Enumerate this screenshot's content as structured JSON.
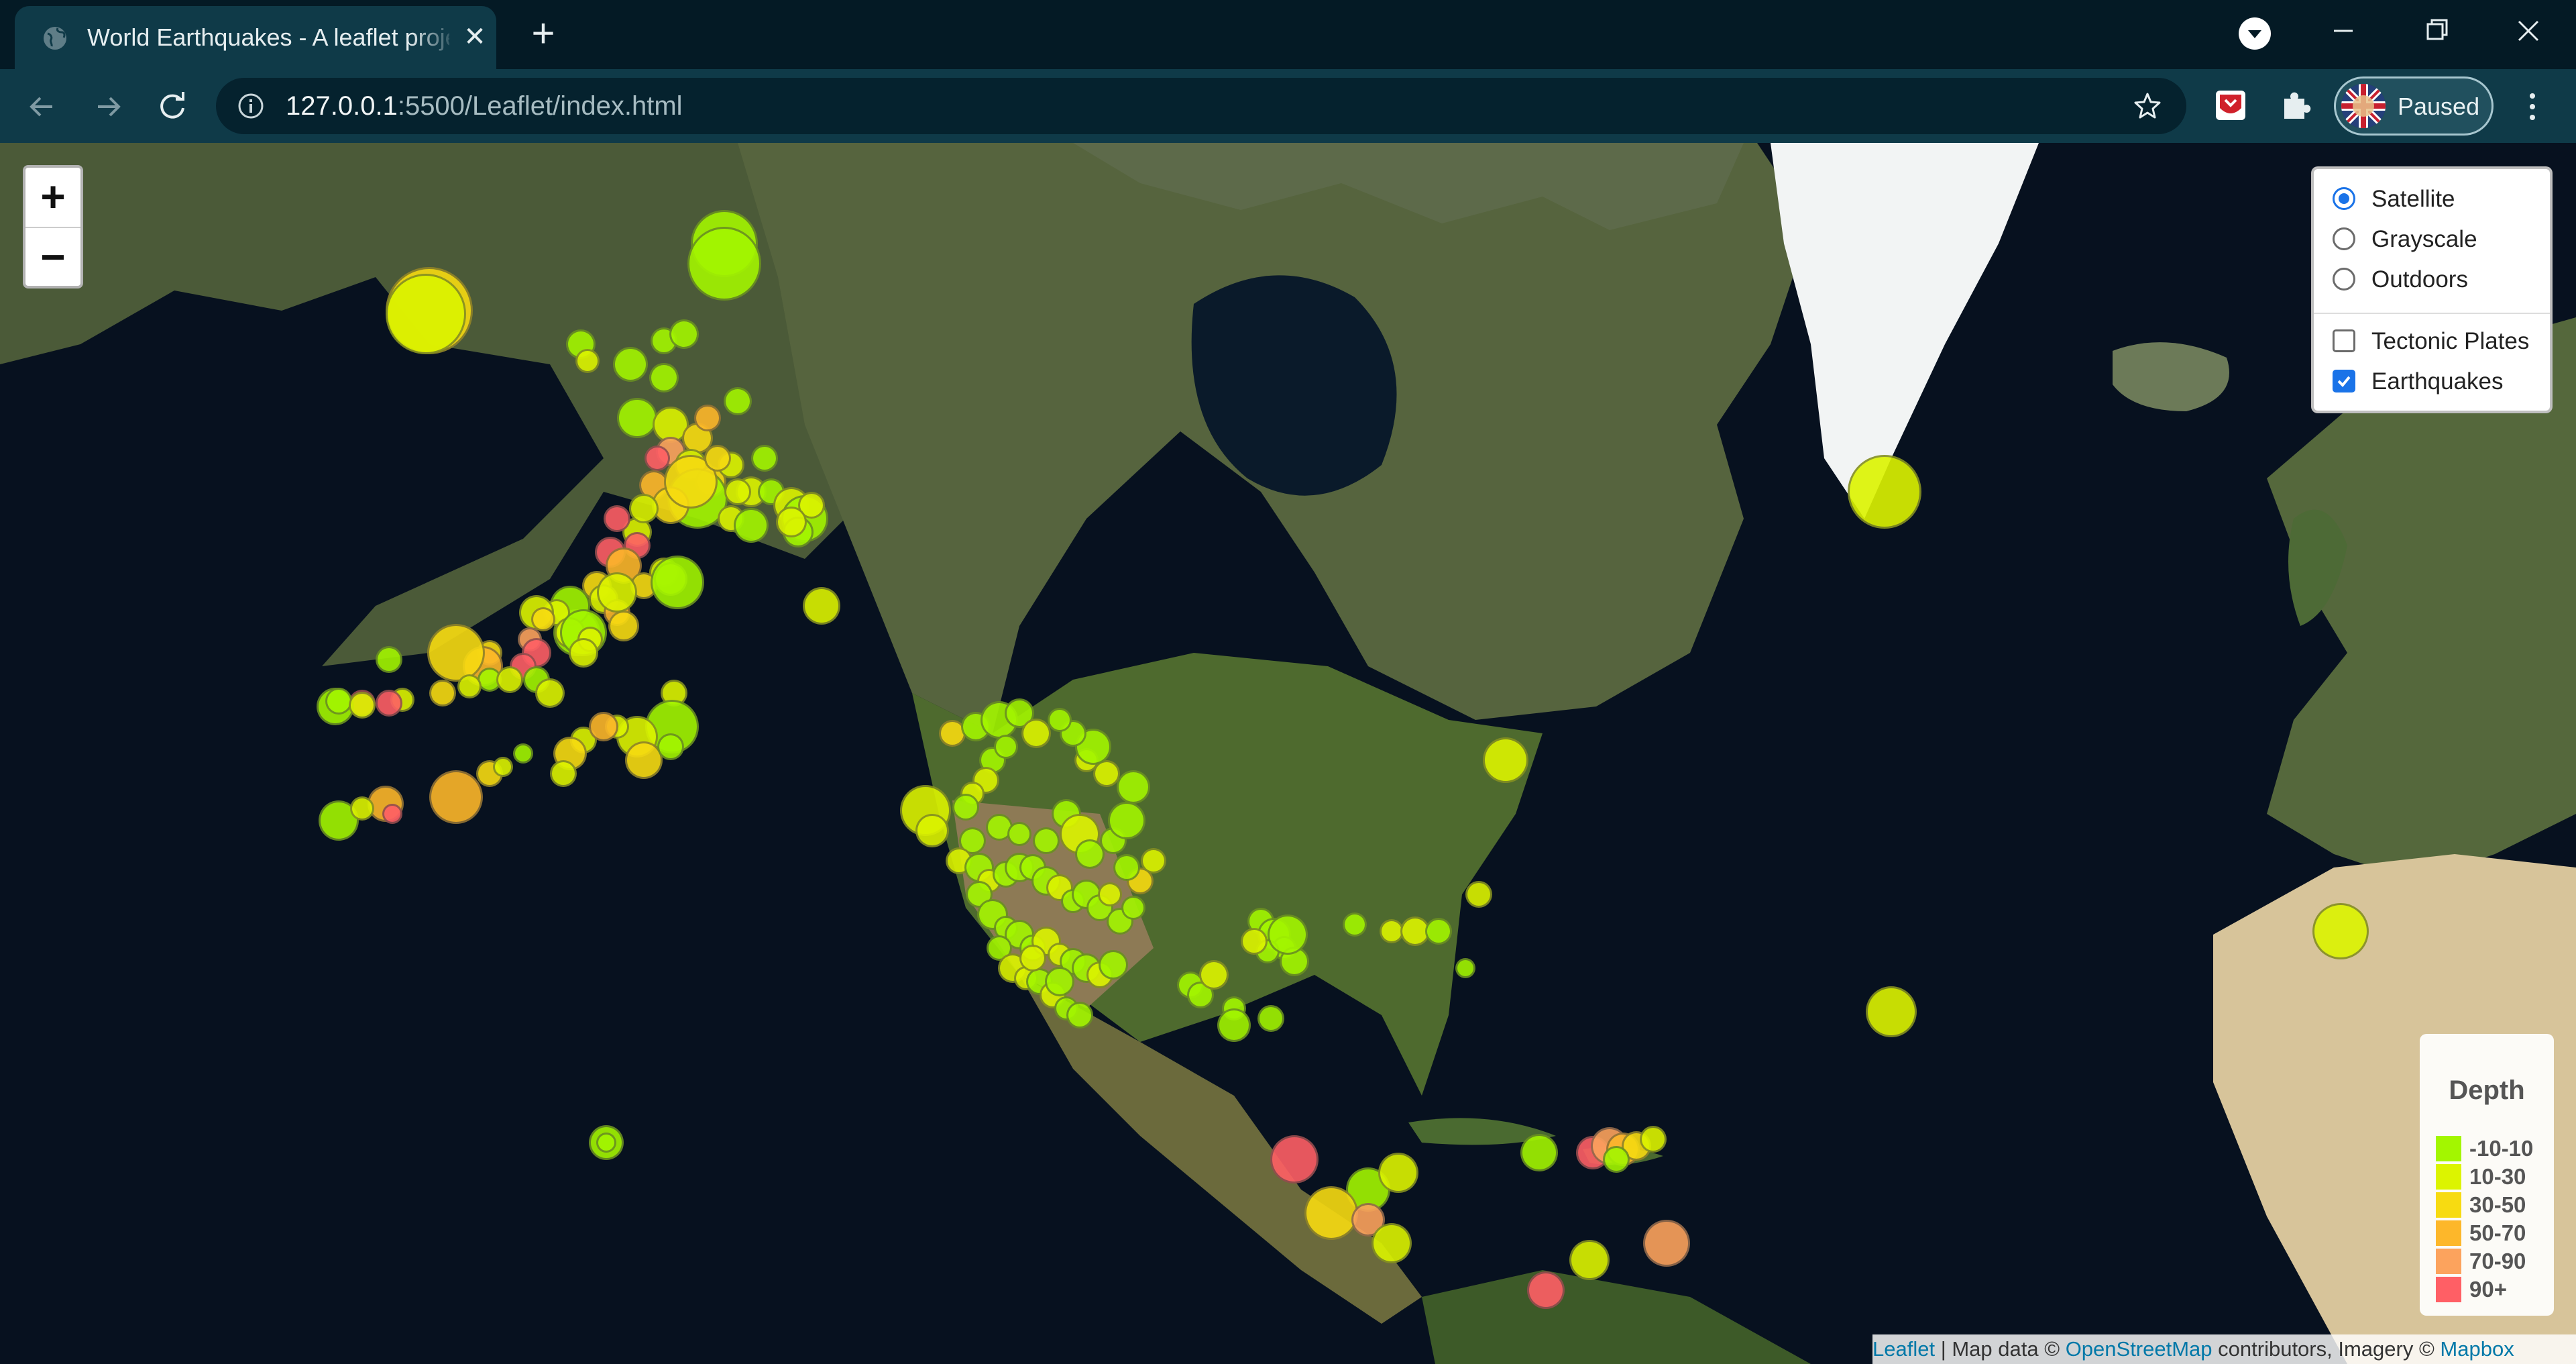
{
  "browser": {
    "tab": {
      "title": "World Earthquakes - A leaflet project",
      "favicon": "globe-icon"
    },
    "url": {
      "host": "127.0.0.1",
      "rest": ":5500/Leaflet/index.html"
    },
    "profile": {
      "label": "Paused"
    }
  },
  "map": {
    "zoom": {
      "in_label": "+",
      "out_label": "−"
    },
    "layer_control": {
      "base_layers": [
        {
          "label": "Satellite",
          "selected": true
        },
        {
          "label": "Grayscale",
          "selected": false
        },
        {
          "label": "Outdoors",
          "selected": false
        }
      ],
      "overlays": [
        {
          "label": "Tectonic Plates",
          "checked": false
        },
        {
          "label": "Earthquakes",
          "checked": true
        }
      ]
    },
    "legend": {
      "title": "Depth",
      "items": [
        {
          "label": "-10-10",
          "color": "#a3f600"
        },
        {
          "label": "10-30",
          "color": "#dcf400"
        },
        {
          "label": "30-50",
          "color": "#f7db11"
        },
        {
          "label": "50-70",
          "color": "#fdb72a"
        },
        {
          "label": "70-90",
          "color": "#fca35d"
        },
        {
          "label": "90+",
          "color": "#ff5f65"
        }
      ]
    },
    "attribution": {
      "leaflet": "Leaflet",
      "sep": " | Map data © ",
      "osm": "OpenStreetMap",
      "mid": " contributors, Imagery © ",
      "mapbox": "Mapbox"
    }
  }
}
